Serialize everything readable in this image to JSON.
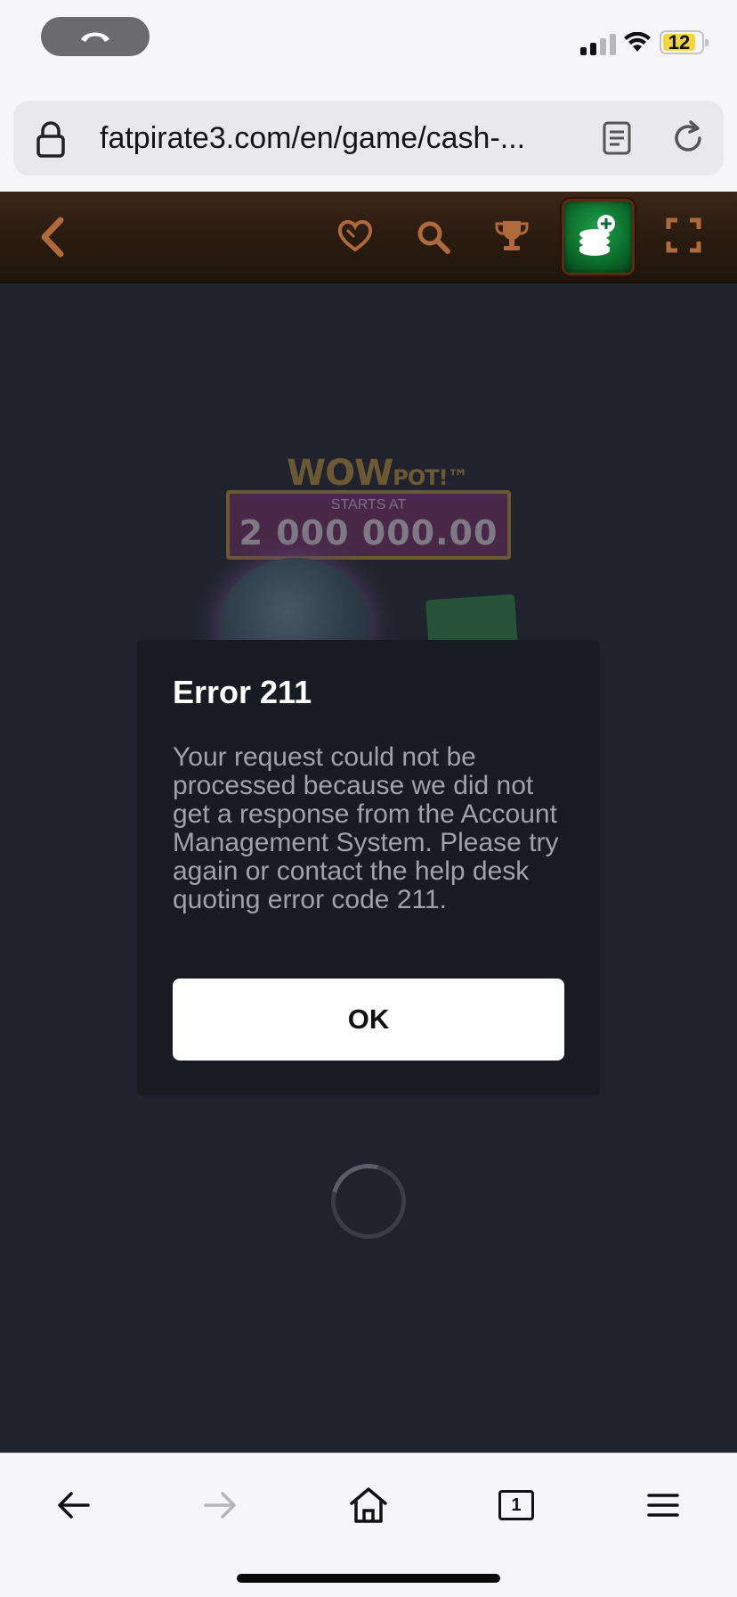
{
  "status_bar": {
    "call_icon": "phone-hangup-icon",
    "battery_level": "12",
    "signal_bars_active": 2,
    "signal_bars_total": 4
  },
  "browser": {
    "url": "fatpirate3.com/en/game/cash-...",
    "lock_icon": "lock-icon",
    "reader_icon": "reader-mode-icon",
    "reload_icon": "reload-icon"
  },
  "game_header": {
    "back_icon": "chevron-left-icon",
    "favorite_icon": "heart-icon",
    "search_icon": "search-icon",
    "trophy_icon": "trophy-icon",
    "deposit_icon": "cash-deposit-icon",
    "fullscreen_icon": "fullscreen-icon",
    "accent_color": "#b0693a",
    "deposit_color": "#0c6b2b"
  },
  "game_background": {
    "brand": "WOW",
    "brand_suffix": "POT!™",
    "starts_at": "STARTS AT",
    "jackpot_amount": "2 000 000.00"
  },
  "error_dialog": {
    "title": "Error 211",
    "message": "Your request could not be processed because we did not get a response from the Account Management System. Please try again or contact the help desk quoting error code 211.",
    "ok_label": "OK"
  },
  "toolbar": {
    "back_icon": "arrow-left-icon",
    "forward_icon": "arrow-right-icon",
    "home_icon": "home-icon",
    "tabs_count": "1",
    "menu_icon": "hamburger-menu-icon"
  }
}
